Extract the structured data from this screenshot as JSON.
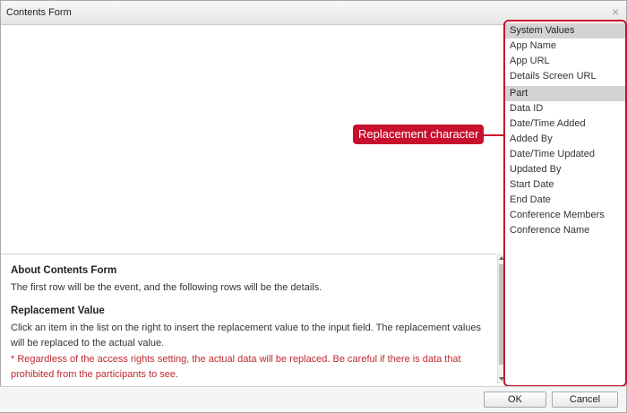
{
  "dialog": {
    "title": "Contents Form",
    "close_glyph": "×"
  },
  "editor": {
    "value": ""
  },
  "help": {
    "about_heading": "About Contents Form",
    "about_text": "The first row will be the event, and the following rows will be the details.",
    "replacement_heading": "Replacement Value",
    "replacement_text": "Click an item in the list on the right to insert the replacement value to the input field. The replacement values will be replaced to the actual value.",
    "warning_text": "* Regardless of the access rights setting, the actual data will be replaced. Be careful if there is data that prohibited from the participants to see."
  },
  "sidebar": {
    "system_header": "System Values",
    "system_items": [
      "App Name",
      "App URL",
      "Details Screen URL"
    ],
    "part_header": "Part",
    "part_items": [
      "Data ID",
      "Date/Time Added",
      "Added By",
      "Date/Time Updated",
      "Updated By",
      "Start Date",
      "End Date",
      "Conference Members",
      "Conference Name"
    ]
  },
  "callout": {
    "label": "Replacement character"
  },
  "footer": {
    "ok_label": "OK",
    "cancel_label": "Cancel"
  },
  "colors": {
    "accent_red": "#c8102e",
    "warning_text": "#c0282d",
    "header_gray": "#d3d3d3"
  }
}
